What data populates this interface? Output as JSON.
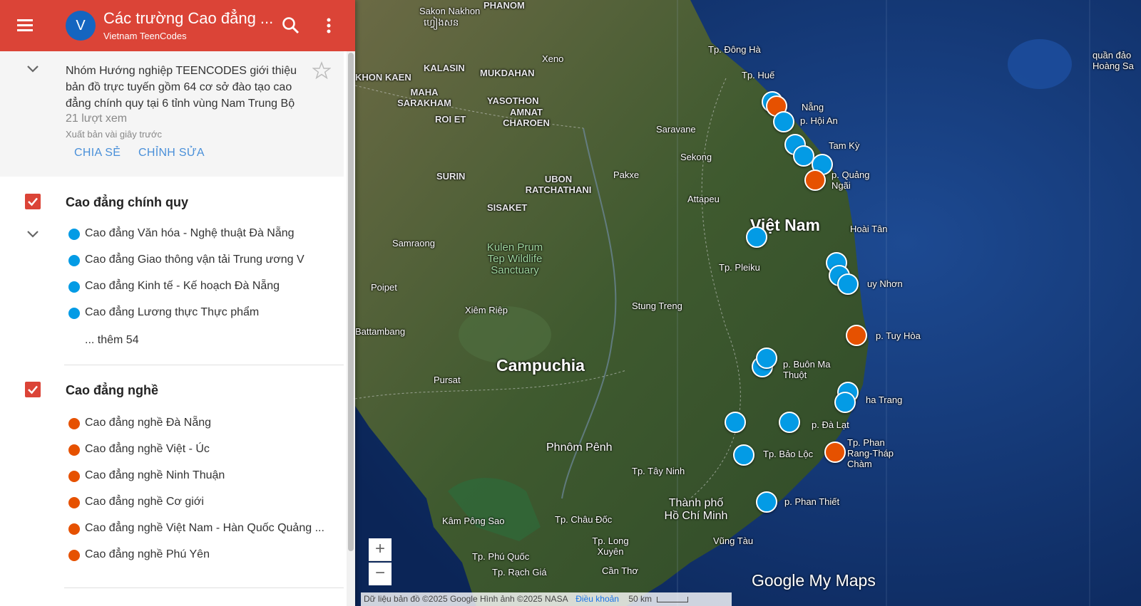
{
  "header": {
    "avatar_letter": "V",
    "title": "Các trường Cao đẳng ...",
    "owner": "Vietnam TeenCodes",
    "color": "#db4437"
  },
  "description": {
    "text": "Nhóm Hướng nghiệp TEENCODES giới thiệu bản đồ trực tuyến gồm 64 cơ sở đào tạo cao đẳng chính quy tại 6 tỉnh vùng Nam Trung Bộ",
    "views": "21 lượt xem",
    "published": "Xuất bản vài giây trước",
    "share_label": "CHIA SẺ",
    "edit_label": "CHỈNH SỬA"
  },
  "layers": [
    {
      "title": "Cao đẳng chính quy",
      "checked": true,
      "icon_color": "#039be5",
      "items": [
        "Cao đẳng Văn hóa - Nghệ thuật Đà Nẵng",
        "Cao đẳng Giao thông vận tải Trung ương V",
        "Cao đẳng Kinh tế - Kế hoạch Đà Nẵng",
        "Cao đẳng Lương thực Thực phẩm"
      ],
      "more": "... thêm 54"
    },
    {
      "title": "Cao đẳng nghề",
      "checked": true,
      "icon_color": "#e65100",
      "items": [
        "Cao đẳng nghề Đà Nẵng",
        "Cao đẳng nghề Việt - Úc",
        "Cao đẳng nghề Ninh Thuận",
        "Cao đẳng nghề Cơ giới",
        "Cao đẳng nghề Việt Nam - Hàn Quốc Quảng ...",
        "Cao đẳng nghề Phú Yên"
      ]
    }
  ],
  "map": {
    "labels": [
      "PHANOM",
      "Sakon Nakhon",
      "ហ្វៀងសន",
      "Xeno",
      "KALASIN",
      "MUKDAHAN",
      "KHON KAEN",
      "MAHA SARAKHAM",
      "YASOTHON",
      "AMNAT CHAROEN",
      "ROI ET",
      "Saravane",
      "Sekong",
      "SURIN",
      "UBON RATCHATHANI",
      "Pakxe",
      "Attapeu",
      "SISAKET",
      "Samraong",
      "Kulen Prum Tep Wildlife Sanctuary",
      "Poipet",
      "Xiêm Riệp",
      "Stung Treng",
      "Battambang",
      "Campuchia",
      "Pursat",
      "Phnôm Pênh",
      "Kâm Pông Sao",
      "Tp. Đông Hà",
      "Tp. Huế",
      "Nẵng",
      "p. Hội An",
      "Tam Kỳ",
      "p. Quảng Ngãi",
      "Việt Nam",
      "Hoài Tân",
      "Tp. Pleiku",
      "uy Nhơn",
      "p. Tuy Hòa",
      "p. Buôn Ma Thuột",
      "ha Trang",
      "p. Đà Lạt",
      "Tp. Phan Rang-Tháp Chàm",
      "Tp. Bảo Lộc",
      "Tp. Tây Ninh",
      "Thành phố Hồ Chí Minh",
      "p. Phan Thiết",
      "Tp. Châu Đốc",
      "Tp. Long Xuyên",
      "Vũng Tàu",
      "Tp. Phú Quốc",
      "Tp. Rạch Giá",
      "Cần Thơ",
      "quần đảo Hoàng Sa"
    ],
    "zoom_in": "+",
    "zoom_out": "−",
    "attribution": "Dữ liệu bản đồ ©2025 Google Hình ảnh ©2025 NASA",
    "terms": "Điều khoản",
    "scale": "50 km",
    "logo": "Google My Maps",
    "pin_blue": "#039be5",
    "pin_orange": "#e65100"
  }
}
